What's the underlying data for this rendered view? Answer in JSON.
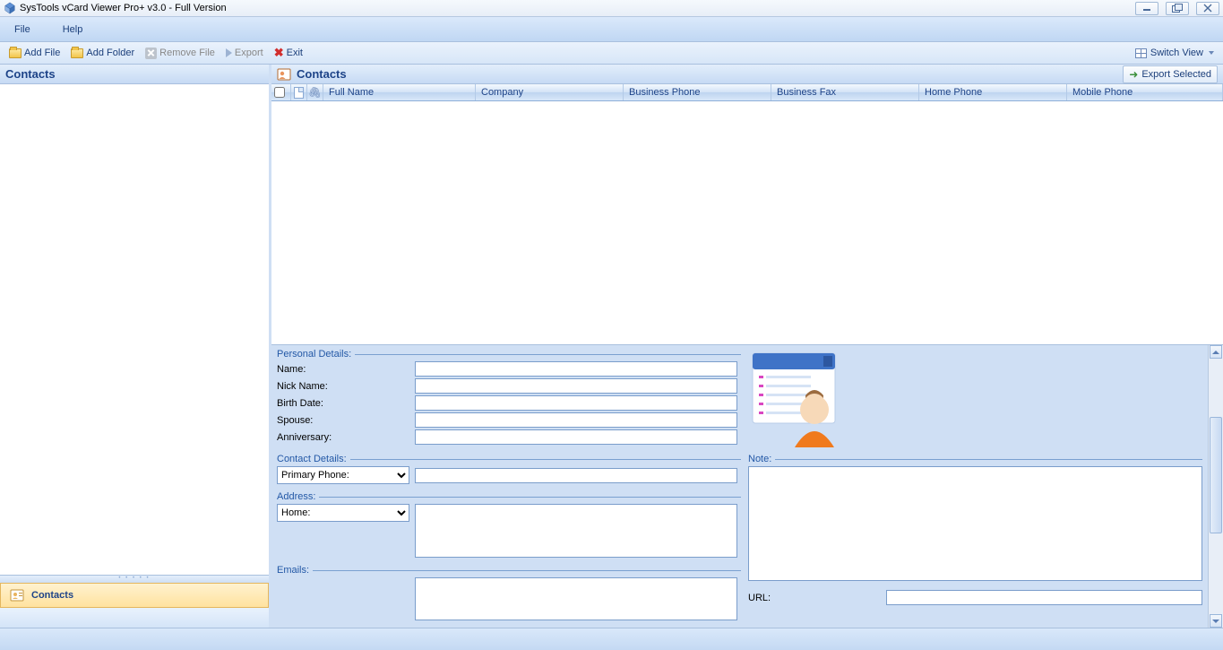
{
  "window": {
    "title": "SysTools vCard Viewer Pro+ v3.0 - Full Version"
  },
  "menu": {
    "file": "File",
    "help": "Help"
  },
  "toolbar": {
    "add_file": "Add File",
    "add_folder": "Add Folder",
    "remove_file": "Remove File",
    "export": "Export",
    "exit": "Exit",
    "switch_view": "Switch View"
  },
  "left_panel": {
    "header": "Contacts",
    "nav_contacts": "Contacts"
  },
  "right_panel": {
    "header": "Contacts",
    "export_selected": "Export Selected",
    "columns": {
      "full_name": "Full Name",
      "company": "Company",
      "business_phone": "Business Phone",
      "business_fax": "Business Fax",
      "home_phone": "Home Phone",
      "mobile_phone": "Mobile Phone"
    }
  },
  "details": {
    "personal_legend": "Personal Details:",
    "name_label": "Name:",
    "nick_label": "Nick Name:",
    "birth_label": "Birth Date:",
    "spouse_label": "Spouse:",
    "anniversary_label": "Anniversary:",
    "contact_legend": "Contact Details:",
    "primary_phone_option": "Primary Phone:",
    "address_legend": "Address:",
    "address_home_option": "Home:",
    "emails_legend": "Emails:",
    "note_legend": "Note:",
    "url_label": "URL:",
    "values": {
      "name": "",
      "nick": "",
      "birth": "",
      "spouse": "",
      "anniversary": "",
      "primary_phone": "",
      "address": "",
      "emails": "",
      "note": "",
      "url": ""
    }
  }
}
